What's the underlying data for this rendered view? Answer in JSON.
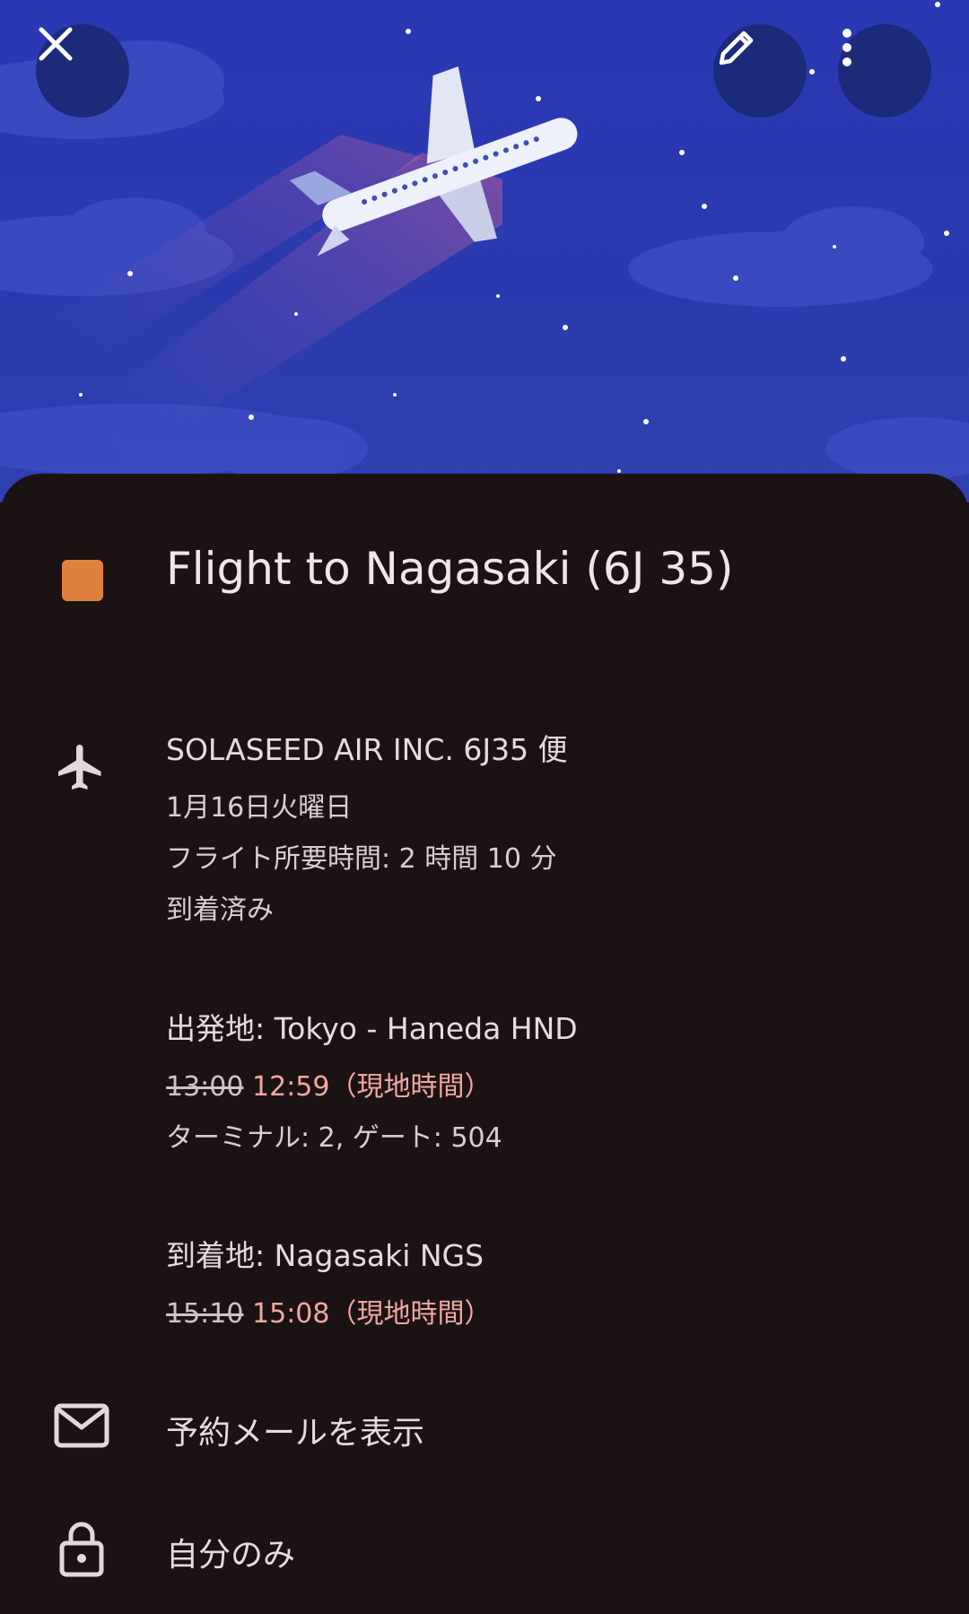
{
  "header": {
    "close_label": "close",
    "edit_label": "edit",
    "more_label": "more options"
  },
  "event": {
    "color": "#e0803f",
    "title": "Flight to Nagasaki (6J 35)"
  },
  "flight": {
    "icon": "airplane-icon",
    "airline": "SOLASEED AIR INC. 6J35 便",
    "date": "1月16日火曜日",
    "duration": "フライト所要時間: 2 時間 10 分",
    "status": "到着済み"
  },
  "departure": {
    "label": "出発地: Tokyo - Haneda HND",
    "scheduled_time": "13:00",
    "actual_time": "12:59（現地時間）",
    "terminal_gate": "ターミナル: 2, ゲート: 504"
  },
  "arrival": {
    "label": "到着地: Nagasaki NGS",
    "scheduled_time": "15:10",
    "actual_time": "15:08（現地時間）"
  },
  "actions": {
    "email_icon": "mail-icon",
    "email_label": "予約メールを表示",
    "visibility_icon": "lock-icon",
    "visibility_label": "自分のみ"
  }
}
